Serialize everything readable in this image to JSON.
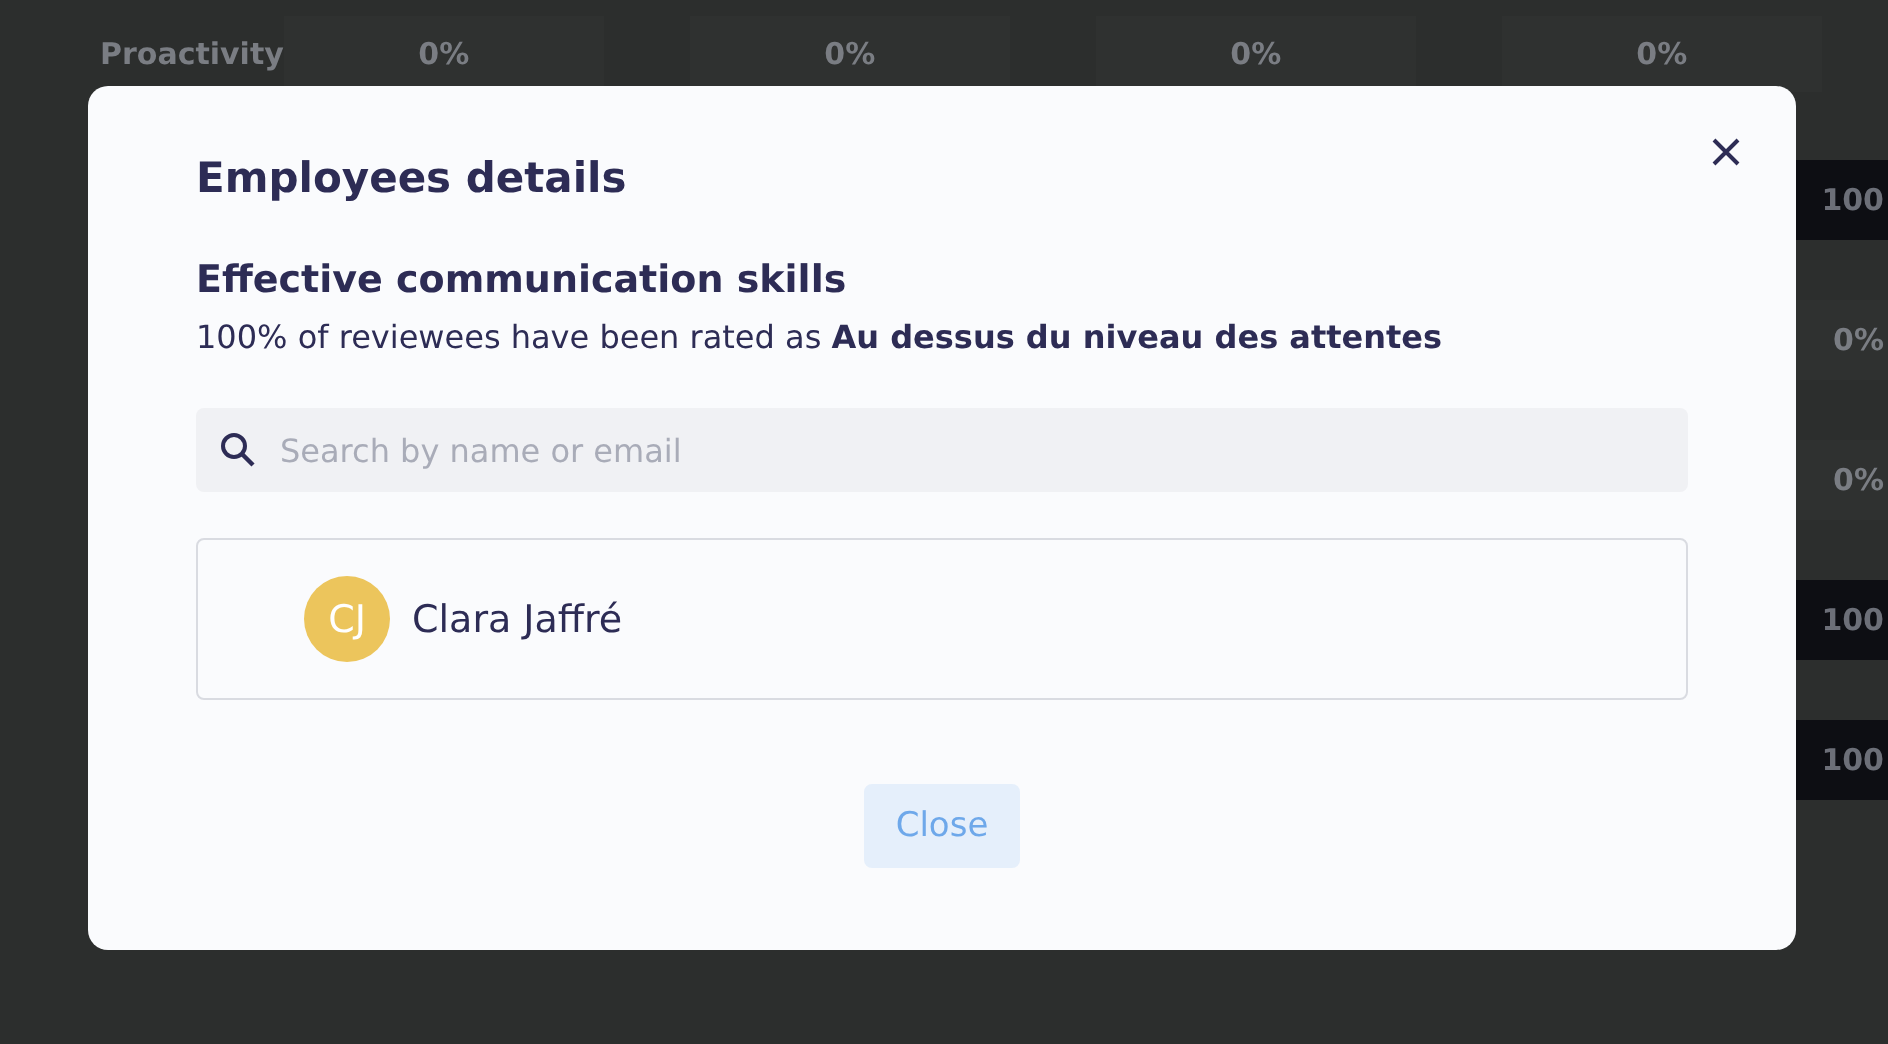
{
  "background_table": {
    "header_row": {
      "label": "Proactivity",
      "cells": [
        "0%",
        "0%",
        "0%",
        "0%"
      ]
    },
    "last_column_cells": [
      {
        "text": "100",
        "kind": "full"
      },
      {
        "text": "0%",
        "kind": "empty"
      },
      {
        "text": "0%",
        "kind": "empty"
      },
      {
        "text": "100",
        "kind": "full"
      },
      {
        "text": "100",
        "kind": "full"
      }
    ]
  },
  "dialog": {
    "title": "Employees details",
    "subtitle": "Effective communication skills",
    "description": "100% of reviewees have been rated as **Au dessus du niveau des attentes**",
    "search": {
      "placeholder": "Search by name or email"
    },
    "employees": [
      {
        "initials": "CJ",
        "name": "Clara Jaffré",
        "color": "#ecc55c"
      }
    ],
    "buttons": [
      "Close"
    ]
  }
}
